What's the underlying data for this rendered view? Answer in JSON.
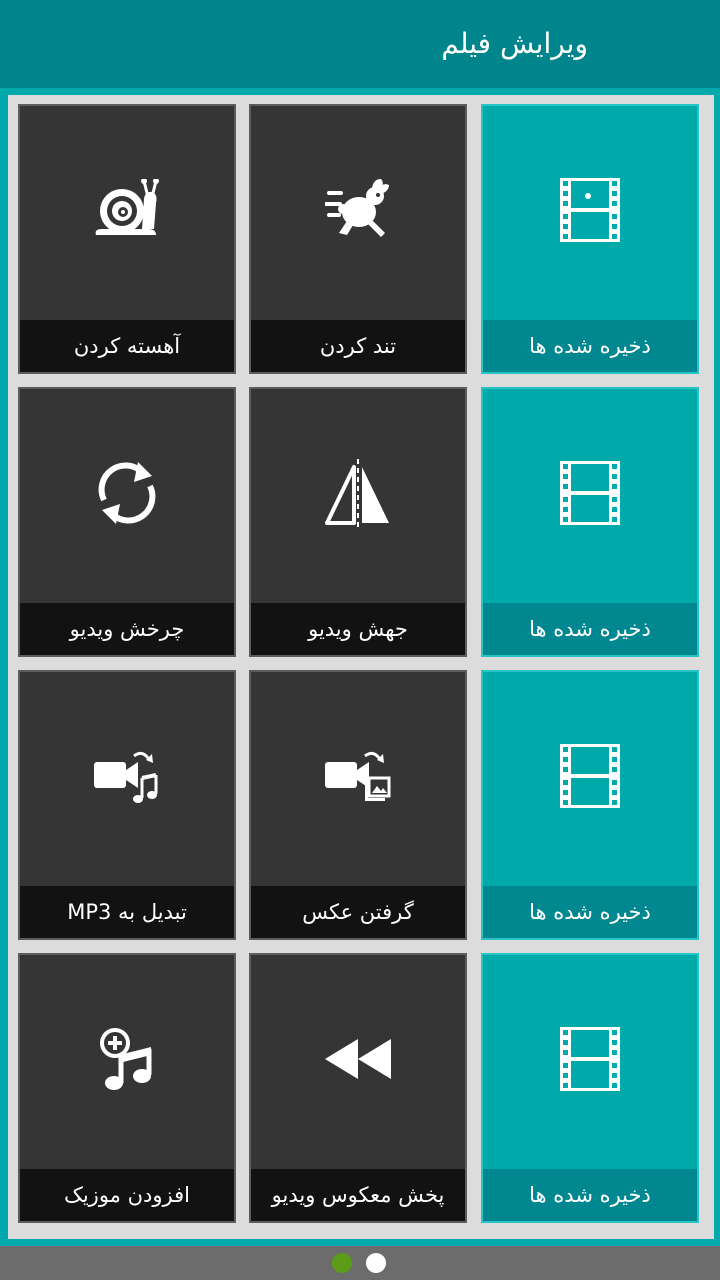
{
  "header": {
    "title": "ویرایش فیلم"
  },
  "tiles": [
    {
      "label": "آهسته کردن",
      "icon": "snail-icon"
    },
    {
      "label": "تند کردن",
      "icon": "running-rabbit-icon"
    },
    {
      "label": "ذخیره شده ها",
      "icon": "saved-film-speed-icon"
    },
    {
      "label": "چرخش ویدیو",
      "icon": "rotate-icon"
    },
    {
      "label": "جهش ویدیو",
      "icon": "flip-icon"
    },
    {
      "label": "ذخیره شده ها",
      "icon": "saved-film-rotate-icon"
    },
    {
      "label": "تبدیل به MP3",
      "icon": "video-to-music-icon"
    },
    {
      "label": "گرفتن عکس",
      "icon": "video-to-image-icon"
    },
    {
      "label": "ذخیره شده ها",
      "icon": "saved-film-convert-icon"
    },
    {
      "label": "افزودن موزیک",
      "icon": "add-music-icon"
    },
    {
      "label": "پخش معکوس ویدیو",
      "icon": "rewind-icon"
    },
    {
      "label": "ذخیره شده ها",
      "icon": "saved-film-music-icon"
    }
  ],
  "pager": {
    "active_color": "#5a9c16",
    "inactive_color": "#ffffff"
  },
  "colors": {
    "appbar": "#00858d",
    "teal_tile": "#00aaab",
    "dark_tile": "#353535",
    "caption": "#121212",
    "teal_caption": "#00878f"
  }
}
